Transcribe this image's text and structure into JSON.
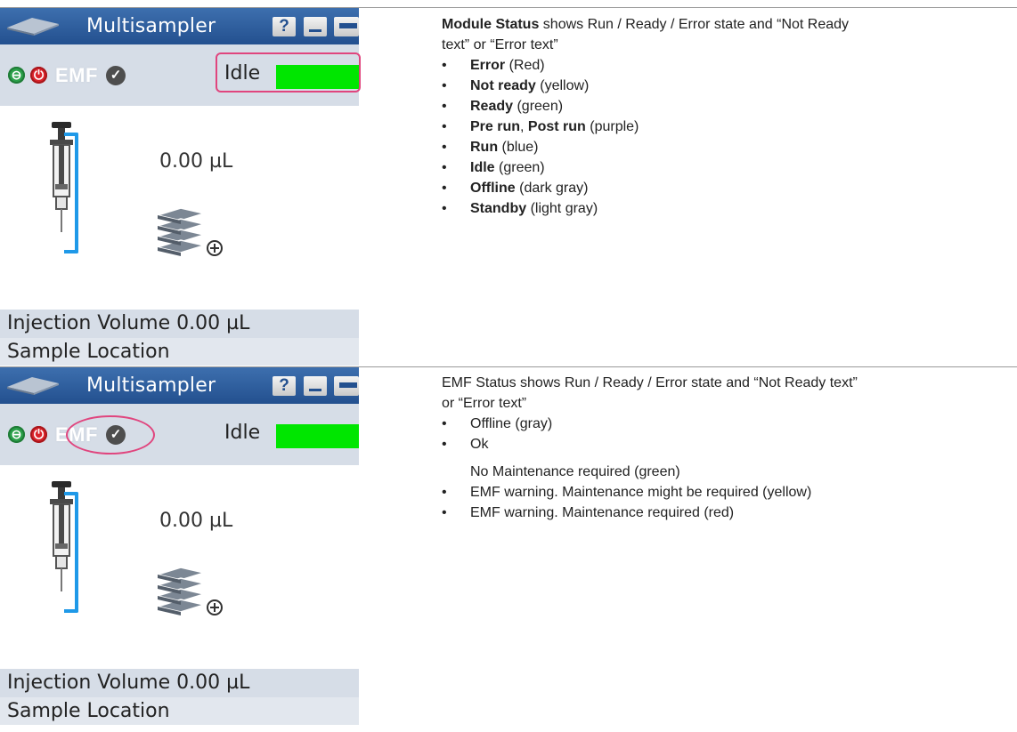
{
  "panel_top": {
    "title": "Multisampler",
    "help_label": "?",
    "emf_label": "EMF",
    "status_text": "Idle",
    "status_color": "#00e600",
    "volume_display": "0.00 µL",
    "injection_volume": "Injection Volume 0.00 µL",
    "sample_location": "Sample Location"
  },
  "panel_bottom": {
    "title": "Multisampler",
    "help_label": "?",
    "emf_label": "EMF",
    "status_text": "Idle",
    "status_color": "#00e600",
    "volume_display": "0.00 µL",
    "injection_volume": "Injection Volume 0.00 µL",
    "sample_location": "Sample Location"
  },
  "module_status": {
    "intro_bold": "Module Status",
    "intro_rest": " shows Run / Ready / Error state and “Not Ready",
    "intro_line2": "text” or “Error text”",
    "items": [
      {
        "bold": "Error",
        "rest": " (Red)"
      },
      {
        "bold": "Not ready",
        "rest": " (yellow)"
      },
      {
        "bold": "Ready",
        "rest": " (green)"
      },
      {
        "bold": "Pre run",
        "mid": ", ",
        "bold2": "Post run",
        "rest": " (purple)"
      },
      {
        "bold": "Run",
        "rest": " (blue)"
      },
      {
        "bold": "Idle",
        "rest": " (green)"
      },
      {
        "bold": "Offline",
        "rest": " (dark gray)"
      },
      {
        "bold": "Standby",
        "rest": " (light gray)"
      }
    ]
  },
  "emf_status": {
    "intro_line1": "EMF Status shows Run / Ready / Error state and “Not Ready text”",
    "intro_line2": "or “Error text”",
    "items": [
      "Offline (gray)",
      "Ok",
      "No Maintenance required (green)",
      "EMF warning. Maintenance might be required (yellow)",
      "EMF warning. Maintenance required (red)"
    ]
  },
  "colors": {
    "highlight": "#e0457e",
    "title_bar": "#2d5d9c",
    "bracket": "#1f99e8"
  }
}
